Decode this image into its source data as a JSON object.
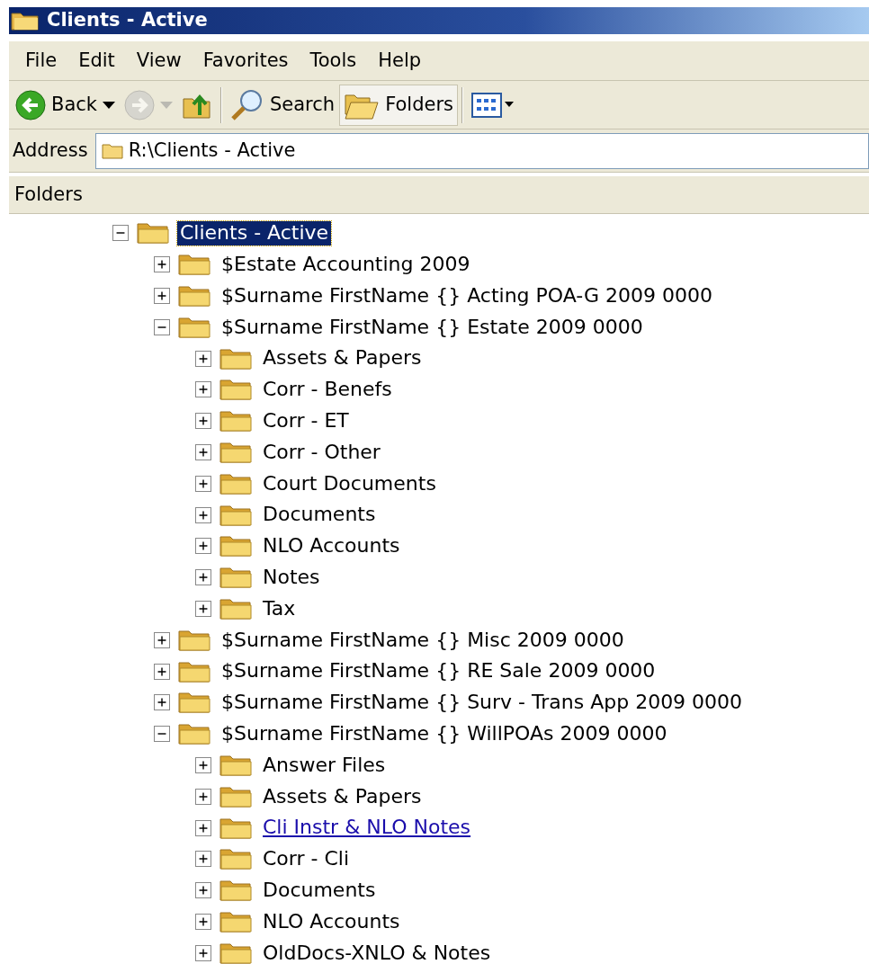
{
  "window": {
    "title": "Clients - Active"
  },
  "menu": [
    "File",
    "Edit",
    "View",
    "Favorites",
    "Tools",
    "Help"
  ],
  "toolbar": [
    {
      "kind": "back",
      "label": "Back",
      "disabled": false,
      "selected": false
    },
    {
      "kind": "forward",
      "disabled": true,
      "selected": false
    },
    {
      "kind": "up",
      "disabled": false,
      "selected": false
    },
    {
      "kind": "search",
      "label": "Search",
      "disabled": false,
      "selected": false
    },
    {
      "kind": "folders",
      "label": "Folders",
      "disabled": false,
      "selected": true
    },
    {
      "kind": "views",
      "disabled": false,
      "selected": false
    }
  ],
  "address": {
    "label": "Address",
    "value": "R:\\Clients - Active"
  },
  "folders_pane": {
    "title": "Folders",
    "tree": [
      {
        "label": "Clients - Active",
        "expanded": true,
        "selected": true,
        "hot": false,
        "children": [
          {
            "label": "$Estate Accounting 2009",
            "expanded": false,
            "selected": false,
            "hot": false
          },
          {
            "label": "$Surname FirstName {} Acting POA-G 2009 0000",
            "expanded": false,
            "selected": false,
            "hot": false
          },
          {
            "label": "$Surname FirstName {} Estate 2009 0000",
            "expanded": true,
            "selected": false,
            "hot": false,
            "children": [
              {
                "label": "Assets & Papers",
                "expanded": false,
                "selected": false,
                "hot": false
              },
              {
                "label": "Corr - Benefs",
                "expanded": false,
                "selected": false,
                "hot": false
              },
              {
                "label": "Corr - ET",
                "expanded": false,
                "selected": false,
                "hot": false
              },
              {
                "label": "Corr - Other",
                "expanded": false,
                "selected": false,
                "hot": false
              },
              {
                "label": "Court Documents",
                "expanded": false,
                "selected": false,
                "hot": false
              },
              {
                "label": "Documents",
                "expanded": false,
                "selected": false,
                "hot": false
              },
              {
                "label": "NLO Accounts",
                "expanded": false,
                "selected": false,
                "hot": false
              },
              {
                "label": "Notes",
                "expanded": false,
                "selected": false,
                "hot": false
              },
              {
                "label": "Tax",
                "expanded": false,
                "selected": false,
                "hot": false
              }
            ]
          },
          {
            "label": "$Surname FirstName {} Misc 2009 0000",
            "expanded": false,
            "selected": false,
            "hot": false
          },
          {
            "label": "$Surname FirstName {} RE Sale 2009 0000",
            "expanded": false,
            "selected": false,
            "hot": false
          },
          {
            "label": "$Surname FirstName {} Surv - Trans App 2009 0000",
            "expanded": false,
            "selected": false,
            "hot": false
          },
          {
            "label": "$Surname FirstName {} WillPOAs 2009 0000",
            "expanded": true,
            "selected": false,
            "hot": false,
            "children": [
              {
                "label": "Answer Files",
                "expanded": false,
                "selected": false,
                "hot": false
              },
              {
                "label": "Assets & Papers",
                "expanded": false,
                "selected": false,
                "hot": false
              },
              {
                "label": "Cli Instr & NLO Notes",
                "expanded": false,
                "selected": false,
                "hot": true
              },
              {
                "label": "Corr - Cli",
                "expanded": false,
                "selected": false,
                "hot": false
              },
              {
                "label": "Documents",
                "expanded": false,
                "selected": false,
                "hot": false
              },
              {
                "label": "NLO Accounts",
                "expanded": false,
                "selected": false,
                "hot": false
              },
              {
                "label": "OldDocs-XNLO & Notes",
                "expanded": false,
                "selected": false,
                "hot": false
              }
            ]
          }
        ]
      }
    ]
  }
}
